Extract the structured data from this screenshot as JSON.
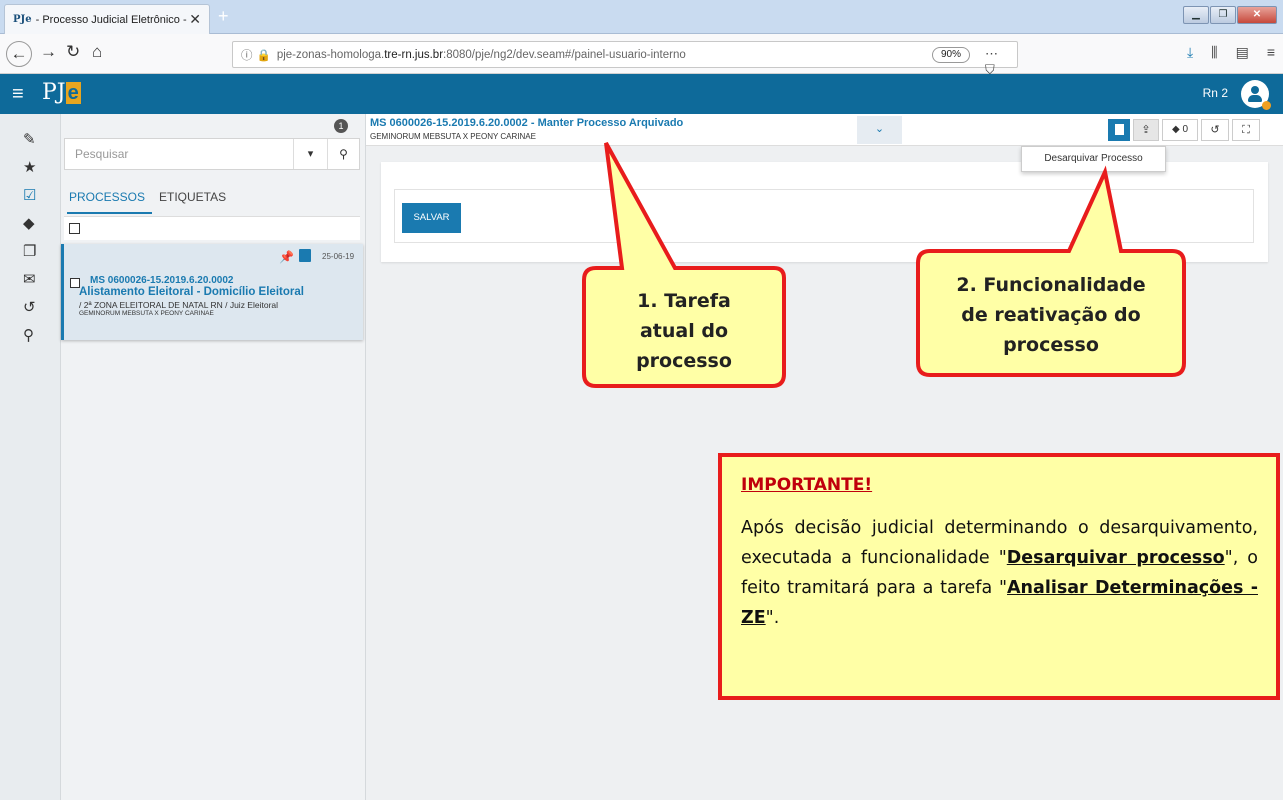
{
  "browser": {
    "tab_title": "- Processo Judicial Eletrônico -",
    "tab_favicon": "PJe",
    "url_prefix": "pje-zonas-homologa.",
    "url_host": "tre-rn.jus.br",
    "url_suffix": ":8080/pje/ng2/dev.seam#/painel-usuario-interno",
    "zoom": "90%"
  },
  "app": {
    "logo_text": "PJ",
    "logo_e": "e",
    "user_name": "Rn 2"
  },
  "sidebar": {
    "icons": [
      "pencil-icon",
      "star-icon",
      "checkbox-icon",
      "tags-icon",
      "copy-icon",
      "envelope-icon",
      "history-icon",
      "search-icon"
    ]
  },
  "list": {
    "search_placeholder": "Pesquisar",
    "count": "1",
    "tab_processos": "PROCESSOS",
    "tab_etiquetas": "ETIQUETAS",
    "card": {
      "date": "25-06-19",
      "number": "MS 0600026-15.2019.6.20.0002",
      "task": "Alistamento Eleitoral - Domicílio Eleitoral",
      "location": "/ 2ª ZONA ELEITORAL DE NATAL RN / Juiz Eleitoral",
      "parties": "GEMINORUM MEBSUTA X PEONY CARINAE"
    }
  },
  "main": {
    "process_title": "MS 0600026-15.2019.6.20.0002 - Manter Processo Arquivado",
    "process_parties": "GEMINORUM MEBSUTA X PEONY CARINAE",
    "tag_count": "0",
    "tooltip": "Desarquivar Processo",
    "save_label": "SALVAR"
  },
  "callouts": {
    "c1_line1": "1. Tarefa",
    "c1_line2": "atual do",
    "c1_line3": "processo",
    "c2_line1": "2. Funcionalidade",
    "c2_line2": "de reativação do",
    "c2_line3": "processo"
  },
  "important": {
    "title": "IMPORTANTE!",
    "text_1": "Após decisão judicial determinando o desarquivamento, executada a funcionalidade \"",
    "bold_1": "Desarquivar processo",
    "text_2": "\", o feito tramitará para a tarefa  \"",
    "bold_2": "Analisar Determinações - ZE",
    "text_3": "\"."
  },
  "colors": {
    "header_blue": "#0e6a9a",
    "accent_blue": "#1a7ab0",
    "callout_fill": "#ffffa6",
    "callout_border": "#e81c1c"
  }
}
